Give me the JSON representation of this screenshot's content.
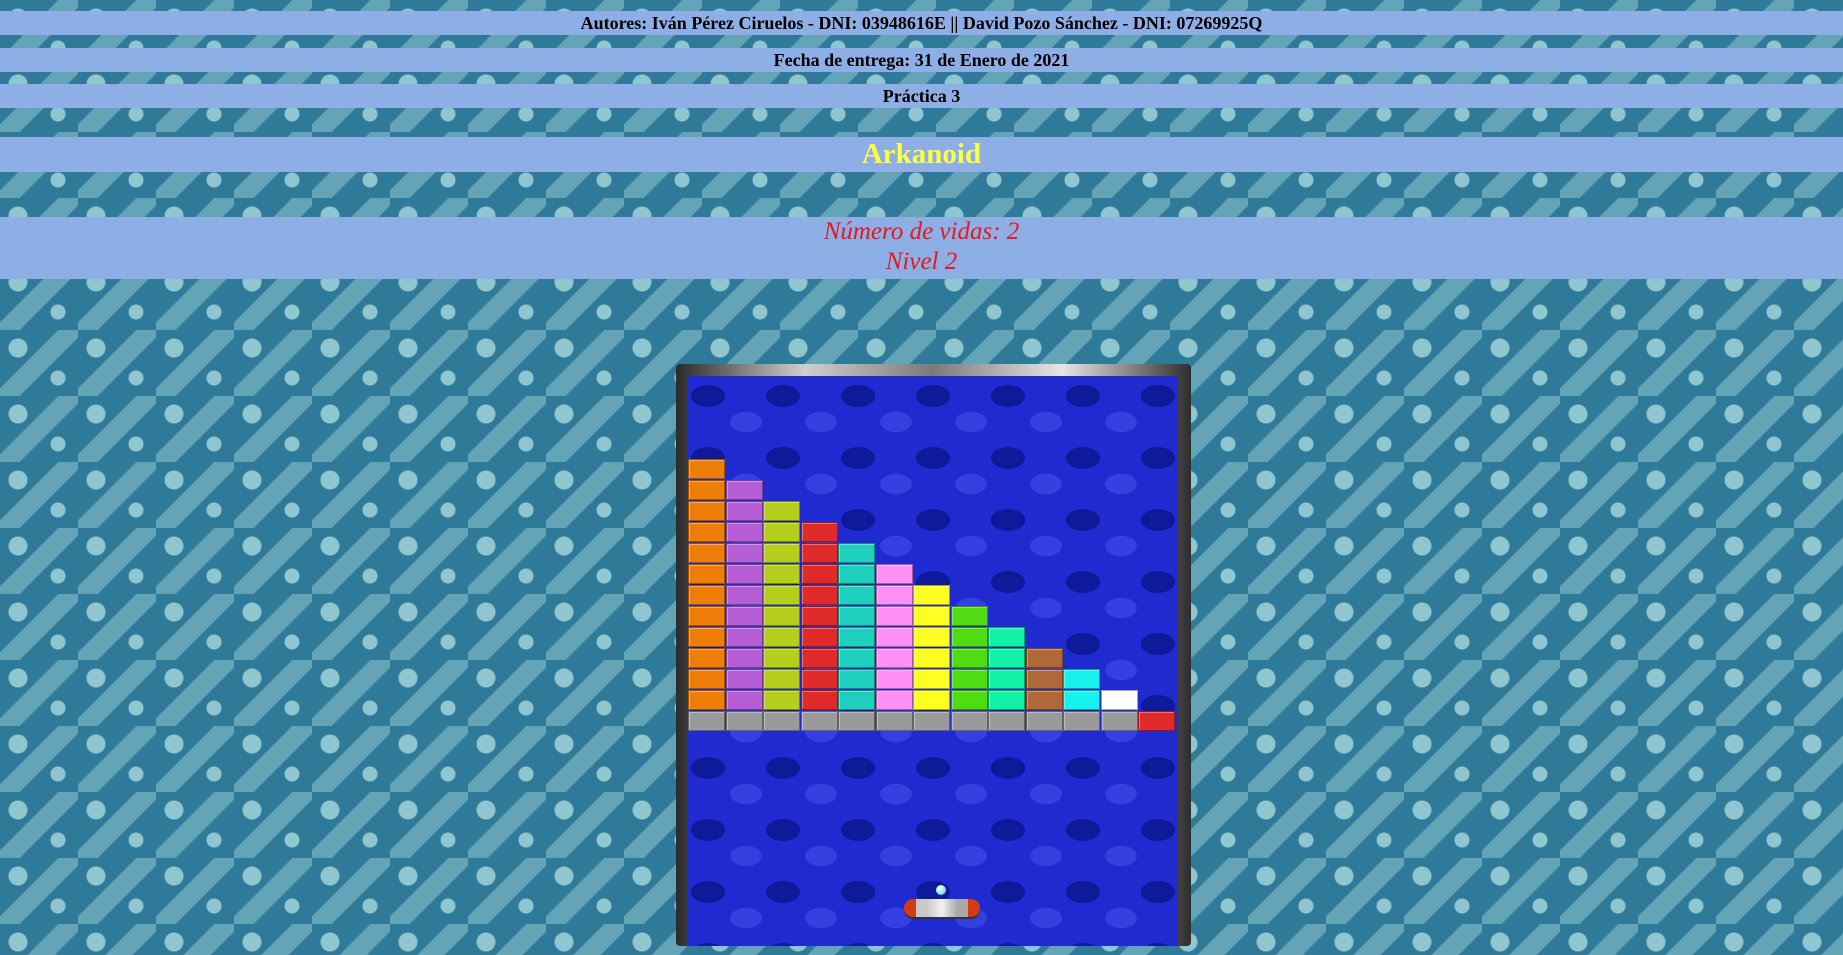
{
  "header": {
    "authors": "Autores: Iván Pérez Ciruelos - DNI: 03948616E || David Pozo Sánchez - DNI: 07269925Q",
    "date": "Fecha de entrega: 31 de Enero de 2021",
    "practice": "Práctica 3",
    "title": "Arkanoid"
  },
  "status": {
    "lives": "Número de vidas: 2",
    "level": "Nivel 2"
  },
  "game": {
    "columns": [
      {
        "color": "#ee7d0a",
        "rows": 12
      },
      {
        "color": "#b55ed6",
        "rows": 11
      },
      {
        "color": "#b6cf1c",
        "rows": 10
      },
      {
        "color": "#e02a2a",
        "rows": 9
      },
      {
        "color": "#1fcfbd",
        "rows": 8
      },
      {
        "color": "#ff8ff5",
        "rows": 7
      },
      {
        "color": "#ffff22",
        "rows": 6
      },
      {
        "color": "#4fdc12",
        "rows": 5
      },
      {
        "color": "#12f2a6",
        "rows": 4
      },
      {
        "color": "#b0683a",
        "rows": 3
      },
      {
        "color": "#18f2ee",
        "rows": 2
      },
      {
        "color": "#ffffff",
        "rows": 1
      },
      {
        "color": "#e02a2a",
        "rows": 1
      }
    ],
    "base_brick_color": "#9a9a9a",
    "paddle_icon": "vaus-paddle",
    "ball_icon": "ball"
  }
}
